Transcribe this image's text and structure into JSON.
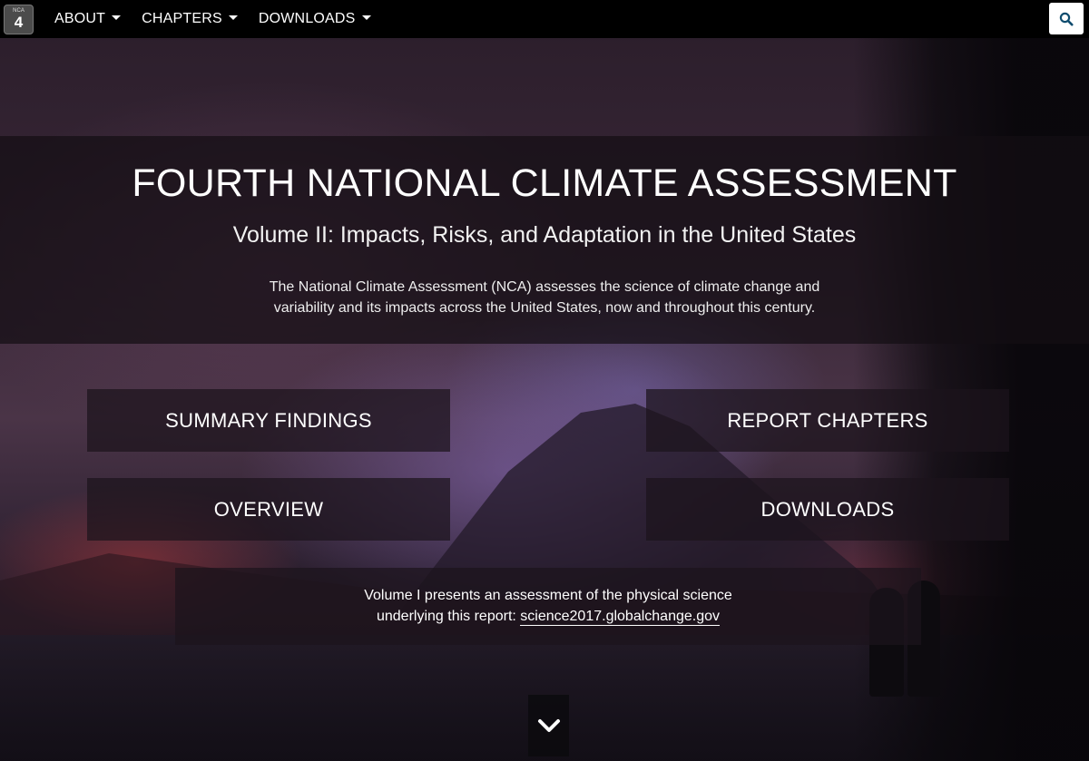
{
  "navbar": {
    "logo": {
      "top_text": "NCA",
      "number": "4"
    },
    "items": [
      {
        "label": "ABOUT"
      },
      {
        "label": "CHAPTERS"
      },
      {
        "label": "DOWNLOADS"
      }
    ],
    "search_icon": "search-icon"
  },
  "hero": {
    "title": "FOURTH NATIONAL CLIMATE ASSESSMENT",
    "subtitle": "Volume II: Impacts, Risks, and Adaptation in the United States",
    "description": "The National Climate Assessment (NCA) assesses the science of climate change and variability and its impacts across the United States, now and throughout this century."
  },
  "tiles": {
    "summary_findings": "SUMMARY FINDINGS",
    "report_chapters": "REPORT CHAPTERS",
    "overview": "OVERVIEW",
    "downloads": "DOWNLOADS"
  },
  "volume_note": {
    "line1": "Volume I presents an assessment of the physical science",
    "line2_prefix": "underlying this report: ",
    "link_text": "science2017.globalchange.gov"
  },
  "scroll_icon": "chevron-down-icon",
  "colors": {
    "navbar_bg": "#000000",
    "panel_bg": "rgba(28,20,28,0.72)",
    "text": "#ffffff"
  }
}
